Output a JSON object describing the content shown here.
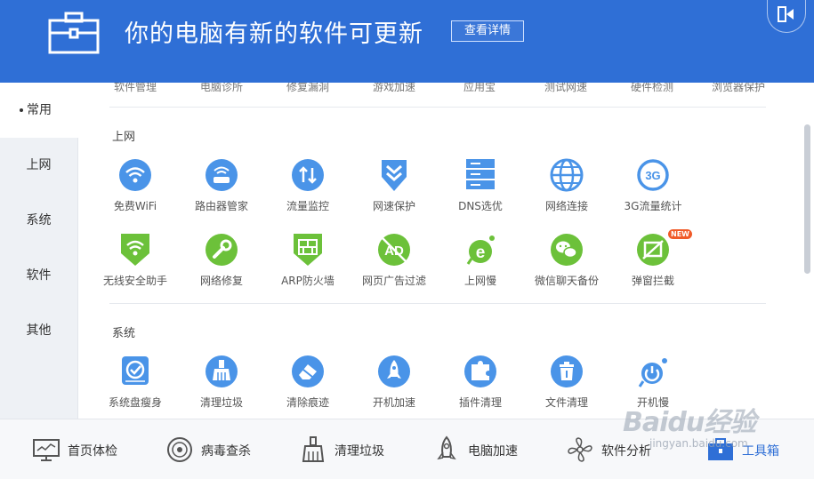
{
  "header": {
    "title": "你的电脑有新的软件可更新",
    "detail_button": "查看详情"
  },
  "sidebar": {
    "items": [
      {
        "label": "常用",
        "active": true
      },
      {
        "label": "上网"
      },
      {
        "label": "系统"
      },
      {
        "label": "软件"
      },
      {
        "label": "其他"
      }
    ]
  },
  "top_strip": [
    "软件管理",
    "电脑诊所",
    "修复漏洞",
    "游戏加速",
    "应用宝",
    "测试网速",
    "硬件检测",
    "浏览器保护"
  ],
  "sections": {
    "internet": {
      "title": "上网",
      "tools": [
        "免费WiFi",
        "路由器管家",
        "流量监控",
        "网速保护",
        "DNS选优",
        "网络连接",
        "3G流量统计",
        "无线安全助手",
        "网络修复",
        "ARP防火墙",
        "网页广告过滤",
        "上网慢",
        "微信聊天备份",
        "弹窗拦截"
      ],
      "badge": "NEW"
    },
    "system": {
      "title": "系统",
      "tools": [
        "系统盘瘦身",
        "清理垃圾",
        "清除痕迹",
        "开机加速",
        "插件清理",
        "文件清理",
        "开机慢"
      ]
    }
  },
  "bottom_nav": [
    {
      "label": "首页体检",
      "icon": "monitor-icon"
    },
    {
      "label": "病毒查杀",
      "icon": "shield-target-icon"
    },
    {
      "label": "清理垃圾",
      "icon": "broom-icon"
    },
    {
      "label": "电脑加速",
      "icon": "rocket-icon"
    },
    {
      "label": "软件分析",
      "icon": "fan-icon"
    },
    {
      "label": "工具箱",
      "icon": "toolbox-icon",
      "active": true
    }
  ],
  "watermark": {
    "text": "Baidu经验",
    "url": "jingyan.baidu.com"
  },
  "colors": {
    "accent": "#2f6fd6",
    "icon_blue": "#4a94e8",
    "icon_green": "#6cc13a",
    "badge": "#f05a28"
  }
}
